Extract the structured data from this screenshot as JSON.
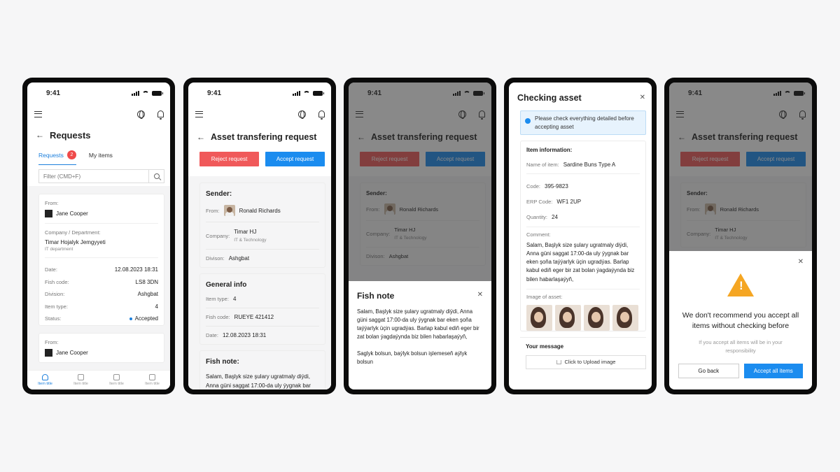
{
  "status_time": "9:41",
  "colors": {
    "accent": "#1b8cef",
    "danger": "#f0595a",
    "warning": "#f5a623",
    "badge": "#ef4a4a"
  },
  "requests_screen": {
    "title": "Requests",
    "tabs": [
      {
        "label": "Requests",
        "badge": "2"
      },
      {
        "label": "My items"
      }
    ],
    "filter_placeholder": "Filter (CMD+F)",
    "card1": {
      "from_label": "From:",
      "from_name": "Jane Cooper",
      "company_label": "Company / Department:",
      "company_name": "Timar Hojalyk Jemgyyeti",
      "company_dept": "IT department",
      "rows": [
        {
          "label": "Date:",
          "value": "12.08.2023 18:31"
        },
        {
          "label": "Fish code:",
          "value": "LS8 3DN"
        },
        {
          "label": "Division:",
          "value": "Ashgbat"
        },
        {
          "label": "Item type:",
          "value": "4"
        }
      ],
      "status_label": "Status:",
      "status_value": "Accepted"
    },
    "card2": {
      "from_label": "From:",
      "from_name": "Jane Cooper"
    },
    "nav": [
      "Item title",
      "Item title",
      "Item title",
      "Item title"
    ]
  },
  "transfer": {
    "title": "Asset transfering request",
    "reject_label": "Reject request",
    "accept_label": "Accept request",
    "sender_heading": "Sender:",
    "from_label": "From:",
    "from_name": "Ronald Richards",
    "company_label": "Company:",
    "company_name": "Timar HJ",
    "company_sub": "IT & Technology",
    "division_label": "Divison:",
    "division_value": "Ashgbat",
    "general_heading": "General info",
    "item_type_label": "Item type:",
    "item_type_value": "4",
    "fish_code_label": "Fish code:",
    "fish_code_value": "RUEYE 421412",
    "date_label": "Date:",
    "date_value": "12.08.2023 18:31",
    "fish_note_heading": "Fish note:",
    "fish_note_text": "Salam, Başlyk size şulary ugratmaly diýdi, Anna güni saggat 17:00-da uly ýygnak bar"
  },
  "fish_note_sheet": {
    "title": "Fish note",
    "para1": "Salam, Başlyk size şulary ugratmaly diýdi, Anna güni saggat 17:00-da uly ýygnak bar eken şoňa taýýarlyk üçin ugradýas. Barlap kabul ediň eger bir zat bolan ýagdaýynda biz bilen habarlaşaýyň,",
    "para2": "Saglyk bolsun, baýlyk bolsun işlemeseň aýlyk bolsun"
  },
  "checking": {
    "title": "Checking asset",
    "banner": "Please check everything detailed before accepting asset",
    "item_info_heading": "Item information:",
    "name_label": "Name of item:",
    "name_value": "Sardine Buns Type A",
    "code_label": "Code:",
    "code_value": "395-9823",
    "erp_label": "ERP Code:",
    "erp_value": "WF1 2UP",
    "qty_label": "Quantity:",
    "qty_value": "24",
    "comment_label": "Comment:",
    "comment_text": "Salam, Başlyk size şulary ugratmaly diýdi, Anna güni saggat 17:00-da uly ýygnak bar eken şoňa taýýarlyk üçin ugradýas. Barlap kabul ediň eger bir zat bolan ýagdaýynda biz bilen habarlaşaýyň,",
    "image_label": "Image of asset:",
    "message_label": "Your message",
    "upload_label": "Click to Upload image"
  },
  "confirm": {
    "title": "We don't recommend you accept all items without checking before",
    "subtitle": "If you accept all items will be in your responsibility",
    "back_label": "Go back",
    "accept_label": "Accept all items",
    "icon": "warning-icon"
  }
}
